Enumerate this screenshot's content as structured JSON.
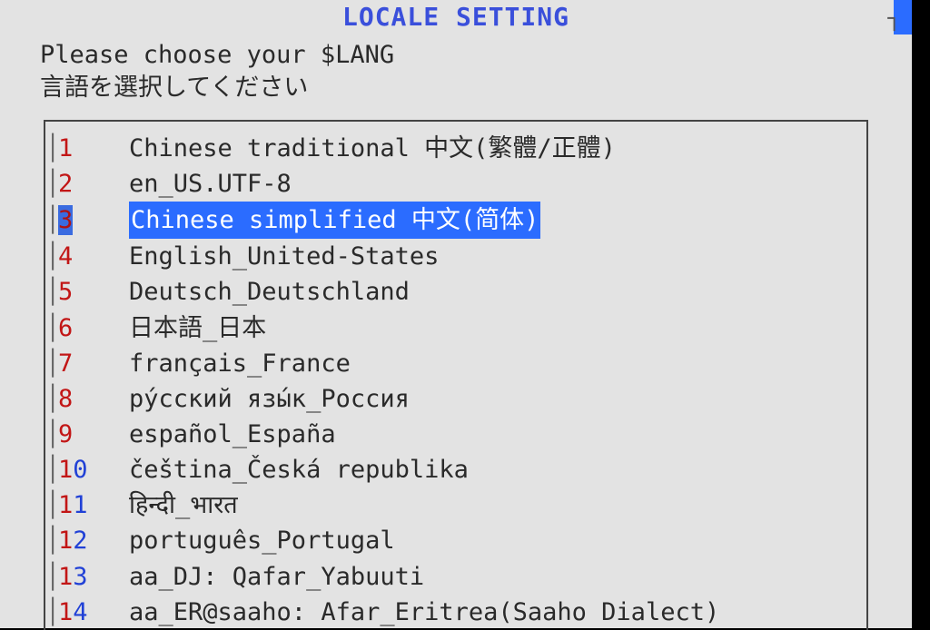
{
  "title": "LOCALE SETTING",
  "prompt_en": "Please choose your $LANG",
  "prompt_jp": "言語を選択してください",
  "selected_index": 2,
  "items": [
    {
      "num": "1",
      "label": "Chinese traditional 中文(繁體/正體)"
    },
    {
      "num": "2",
      "label": "en_US.UTF-8"
    },
    {
      "num": "3",
      "label": "Chinese simplified 中文(简体)"
    },
    {
      "num": "4",
      "label": "English_United-States"
    },
    {
      "num": "5",
      "label": "Deutsch_Deutschland"
    },
    {
      "num": "6",
      "label": "日本語_日本"
    },
    {
      "num": "7",
      "label": "français_France"
    },
    {
      "num": "8",
      "label": "ру́сский язы́к_Россия"
    },
    {
      "num": "9",
      "label": "español_España"
    },
    {
      "num": "10",
      "label": "čeština_Česká republika"
    },
    {
      "num": "11",
      "label": "हिन्दी_भारत"
    },
    {
      "num": "12",
      "label": "português_Portugal"
    },
    {
      "num": "13",
      "label": "aa_DJ: Qafar_Yabuuti"
    },
    {
      "num": "14",
      "label": "aa_ER@saaho: Afar_Eritrea(Saaho Dialect)"
    }
  ]
}
